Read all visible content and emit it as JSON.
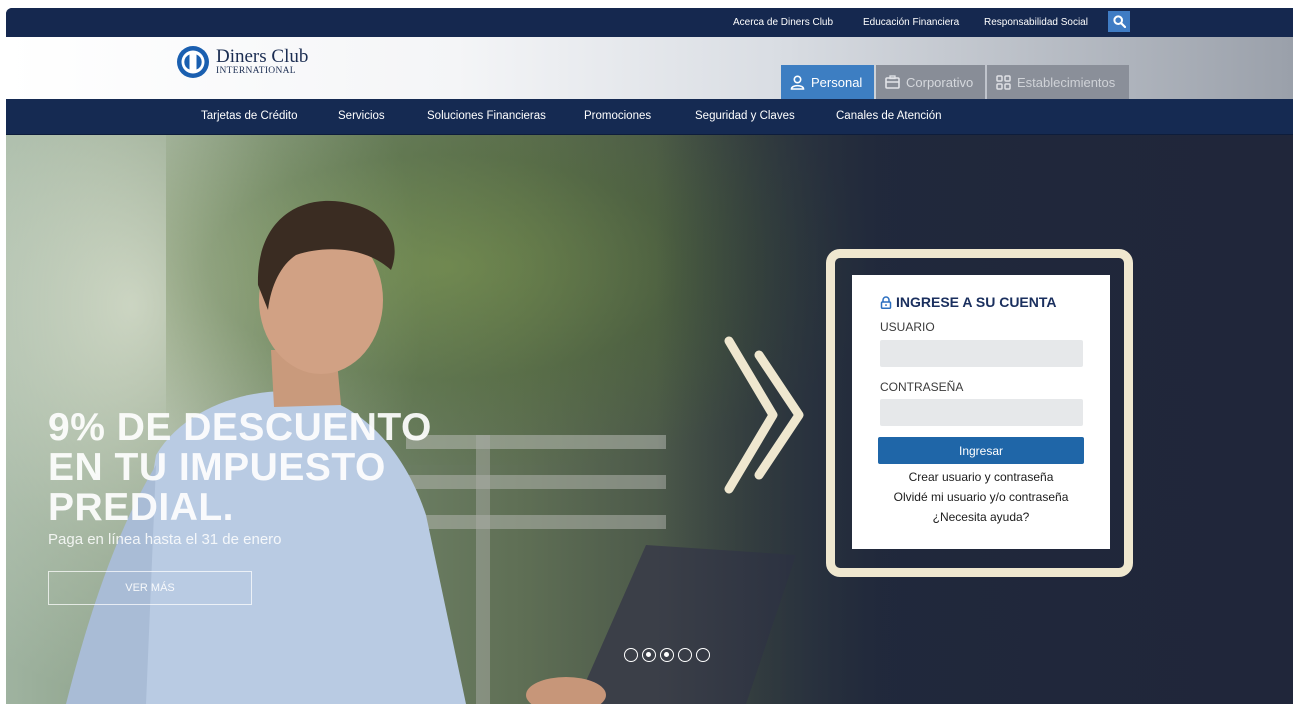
{
  "topbar": {
    "links": [
      "Acerca de Diners Club",
      "Educación Financiera",
      "Responsabilidad Social"
    ]
  },
  "logo": {
    "name": "Diners Club",
    "sub": "INTERNATIONAL"
  },
  "segments": [
    {
      "label": "Personal",
      "icon": "person-icon",
      "active": true
    },
    {
      "label": "Corporativo",
      "icon": "briefcase-icon",
      "active": false
    },
    {
      "label": "Establecimientos",
      "icon": "grid-icon",
      "active": false
    }
  ],
  "nav": {
    "items": [
      "Tarjetas de Crédito",
      "Servicios",
      "Soluciones Financieras",
      "Promociones",
      "Seguridad y Claves",
      "Canales de Atención"
    ]
  },
  "hero": {
    "headline_lines": [
      "9% DE DESCUENTO",
      "EN TU IMPUESTO",
      "PREDIAL."
    ],
    "subline": "Paga en línea hasta el 31 de enero",
    "cta": "VER MÁS",
    "slides": 5,
    "active_slide": 2
  },
  "login": {
    "title": "INGRESE A SU CUENTA",
    "user_label": "USUARIO",
    "password_label": "CONTRASEÑA",
    "submit": "Ingresar",
    "links": [
      "Crear usuario y contraseña",
      "Olvidé mi usuario y/o contraseña",
      "¿Necesita ayuda?"
    ]
  },
  "colors": {
    "navy": "#15284f",
    "accent_blue": "#3d7ec2",
    "button_blue": "#1f66a8",
    "highlight_frame": "#efe7cf"
  }
}
